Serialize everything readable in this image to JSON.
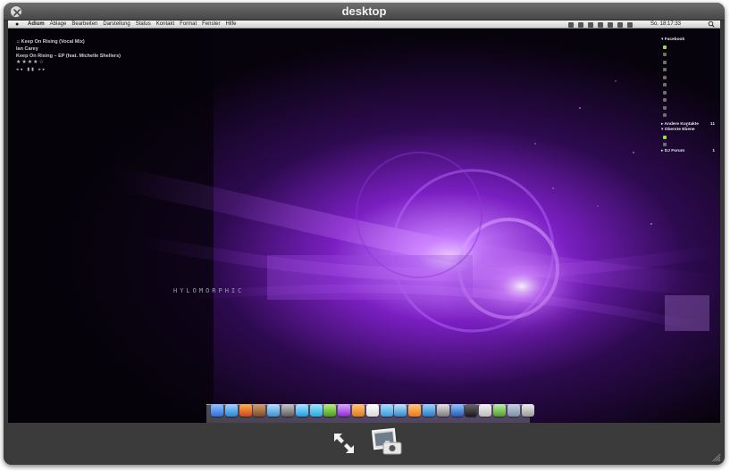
{
  "window": {
    "title": "desktop"
  },
  "menubar": {
    "apple": "",
    "items": [
      "Adium",
      "Ablage",
      "Bearbeiten",
      "Darstellung",
      "Status",
      "Kontakt",
      "Format",
      "Fenster",
      "Hilfe"
    ],
    "clock": "So. 18:17:33"
  },
  "wallpaper": {
    "brand_text": "HYLOMORPHIC"
  },
  "itunes": {
    "song": "♫ Keep On Rising (Vocal Mix)",
    "artist": "Ian Carey",
    "album": "Keep On Rising – EP (feat. Michelle Shellers)",
    "rating": "★★★★☆",
    "controls": "◂◂ ▮▮ ▸▸"
  },
  "contacts": {
    "facebook_group": "▾ Facebook",
    "other_group": "▸ Andere Kontakte",
    "other_count": "11",
    "top_group": "▾ Oberste Ebene",
    "forum_group": "▸ DJ Forum",
    "forum_count": "1"
  },
  "colors": {
    "online": "#9adb53",
    "accent_purple": "#a23cf0",
    "panel_bg": "#3b3b3b"
  },
  "icons": {
    "close": "close-icon",
    "fullscreen": "fullscreen-arrows-icon",
    "add_to_iphoto": "add-to-iphoto-icon",
    "resize": "resize-grip-icon"
  }
}
